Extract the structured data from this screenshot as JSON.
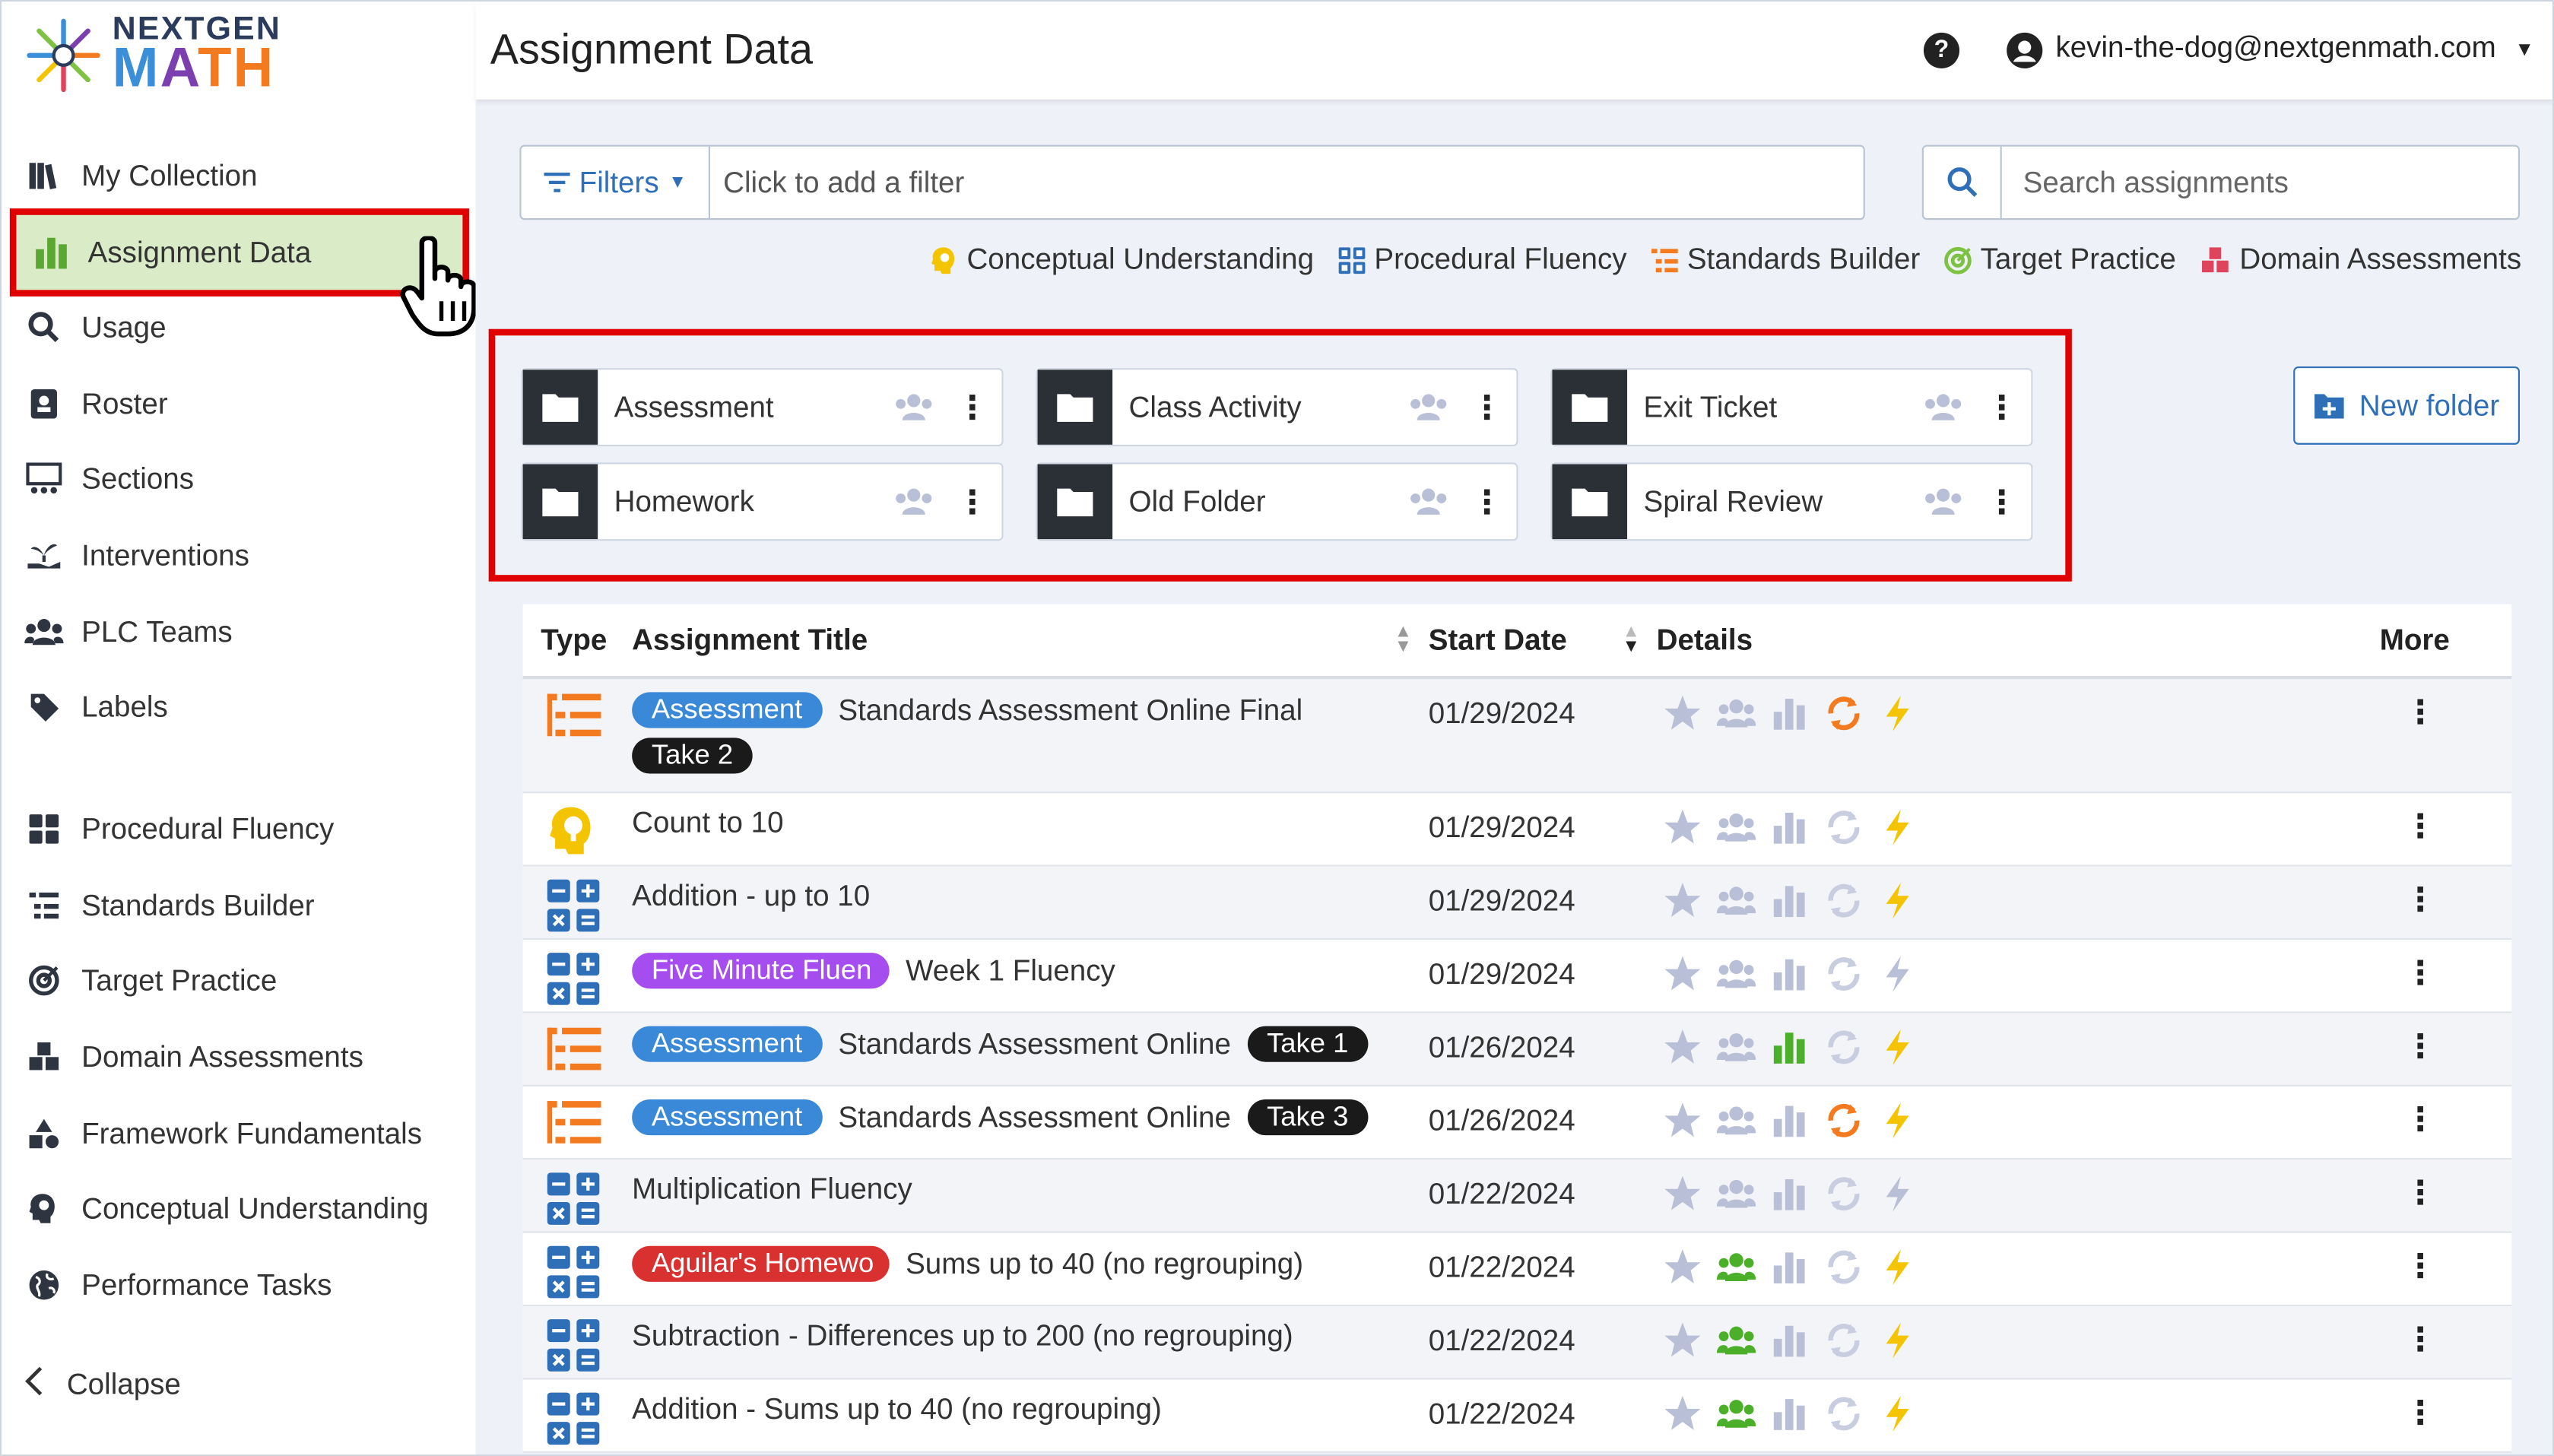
{
  "logo": {
    "line1": "NEXTGEN",
    "line2_m": "M",
    "line2_a": "A",
    "line2_t": "T",
    "line2_h": "H"
  },
  "sidebar": {
    "items": [
      {
        "label": "My Collection",
        "icon": "books-icon"
      },
      {
        "label": "Assignment Data",
        "icon": "bar-chart-icon",
        "active": true
      },
      {
        "label": "Usage",
        "icon": "magnify-chart-icon"
      },
      {
        "label": "Roster",
        "icon": "id-card-icon"
      },
      {
        "label": "Sections",
        "icon": "sections-icon"
      },
      {
        "label": "Interventions",
        "icon": "hand-plant-icon"
      },
      {
        "label": "PLC Teams",
        "icon": "group-icon"
      },
      {
        "label": "Labels",
        "icon": "tag-icon"
      },
      {
        "label": "Procedural Fluency",
        "icon": "grid-icon"
      },
      {
        "label": "Standards Builder",
        "icon": "list-tree-icon"
      },
      {
        "label": "Target Practice",
        "icon": "target-icon"
      },
      {
        "label": "Domain Assessments",
        "icon": "cubes-icon"
      },
      {
        "label": "Framework Fundamentals",
        "icon": "shapes-icon"
      },
      {
        "label": "Conceptual Understanding",
        "icon": "head-lightbulb-icon"
      },
      {
        "label": "Performance Tasks",
        "icon": "globe-icon"
      }
    ],
    "collapse_label": "Collapse"
  },
  "header": {
    "title": "Assignment Data",
    "help": "?",
    "user_email": "kevin-the-dog@nextgenmath.com"
  },
  "filters": {
    "button_label": "Filters",
    "placeholder": "Click to add a filter"
  },
  "search": {
    "placeholder": "Search assignments"
  },
  "legend": [
    {
      "label": "Conceptual Understanding",
      "color": "#f5c400"
    },
    {
      "label": "Procedural Fluency",
      "color": "#2f6fb8"
    },
    {
      "label": "Standards Builder",
      "color": "#f47a20"
    },
    {
      "label": "Target Practice",
      "color": "#7dc242"
    },
    {
      "label": "Domain Assessments",
      "color": "#e0445c"
    }
  ],
  "folders": [
    {
      "name": "Assessment"
    },
    {
      "name": "Class Activity"
    },
    {
      "name": "Exit Ticket"
    },
    {
      "name": "Homework"
    },
    {
      "name": "Old Folder"
    },
    {
      "name": "Spiral Review"
    }
  ],
  "new_folder_label": "New folder",
  "table": {
    "headers": {
      "type": "Type",
      "title": "Assignment Title",
      "start_date": "Start Date",
      "details": "Details",
      "more": "More"
    },
    "rows": [
      {
        "type": "standards-builder",
        "tag": "Assessment",
        "tag_kind": "assess",
        "title": "Standards Assessment Online Final",
        "take": "Take 2",
        "date": "01/29/2024",
        "group_green": false,
        "chart_green": false,
        "cycle_orange": true,
        "bolt": true
      },
      {
        "type": "conceptual",
        "tag": "",
        "tag_kind": "",
        "title": "Count to 10",
        "take": "",
        "date": "01/29/2024",
        "group_green": false,
        "chart_green": false,
        "cycle_orange": false,
        "bolt": true
      },
      {
        "type": "procedural",
        "tag": "",
        "tag_kind": "",
        "title": "Addition - up to 10",
        "take": "",
        "date": "01/29/2024",
        "group_green": false,
        "chart_green": false,
        "cycle_orange": false,
        "bolt": true
      },
      {
        "type": "procedural",
        "tag": "Five Minute Fluen",
        "tag_kind": "five",
        "title": "Week 1 Fluency",
        "take": "",
        "date": "01/29/2024",
        "group_green": false,
        "chart_green": false,
        "cycle_orange": false,
        "bolt": false
      },
      {
        "type": "standards-builder",
        "tag": "Assessment",
        "tag_kind": "assess",
        "title": "Standards Assessment Online",
        "take": "Take 1",
        "date": "01/26/2024",
        "group_green": false,
        "chart_green": true,
        "cycle_orange": false,
        "bolt": true
      },
      {
        "type": "standards-builder",
        "tag": "Assessment",
        "tag_kind": "assess",
        "title": "Standards Assessment Online",
        "take": "Take 3",
        "date": "01/26/2024",
        "group_green": false,
        "chart_green": false,
        "cycle_orange": true,
        "bolt": true
      },
      {
        "type": "procedural",
        "tag": "",
        "tag_kind": "",
        "title": "Multiplication Fluency",
        "take": "",
        "date": "01/22/2024",
        "group_green": false,
        "chart_green": false,
        "cycle_orange": false,
        "bolt": false
      },
      {
        "type": "procedural",
        "tag": "Aguilar's Homewo",
        "tag_kind": "aguilar",
        "title": "Sums up to 40 (no regrouping)",
        "take": "",
        "date": "01/22/2024",
        "group_green": true,
        "chart_green": false,
        "cycle_orange": false,
        "bolt": true
      },
      {
        "type": "procedural",
        "tag": "",
        "tag_kind": "",
        "title": "Subtraction - Differences up to 200 (no regrouping)",
        "take": "",
        "date": "01/22/2024",
        "group_green": true,
        "chart_green": false,
        "cycle_orange": false,
        "bolt": true
      },
      {
        "type": "procedural",
        "tag": "",
        "tag_kind": "",
        "title": "Addition - Sums up to 40 (no regrouping)",
        "take": "",
        "date": "01/22/2024",
        "group_green": true,
        "chart_green": false,
        "cycle_orange": false,
        "bolt": true
      }
    ]
  }
}
